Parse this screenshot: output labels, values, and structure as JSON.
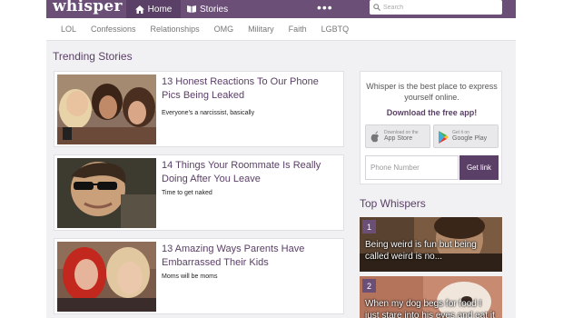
{
  "header": {
    "logo": "whisper",
    "nav_home": "Home",
    "nav_stories": "Stories",
    "more": "•••",
    "search_placeholder": "Search"
  },
  "categories": [
    "LOL",
    "Confessions",
    "Relationships",
    "OMG",
    "Military",
    "Faith",
    "LGBTQ"
  ],
  "trending": {
    "title": "Trending Stories",
    "stories": [
      {
        "title": "13 Honest Reactions To Our Phone Pics Being Leaked",
        "sub": "Everyone's a narcissist, basically"
      },
      {
        "title": "14 Things Your Roommate Is Really Doing After You Leave",
        "sub": "Time to get naked"
      },
      {
        "title": "13 Amazing Ways Parents Have Embarrassed Their Kids",
        "sub": "Moms will be moms"
      }
    ]
  },
  "promo": {
    "text": "Whisper is the best place to express yourself online.",
    "download": "Download the free app!",
    "appstore_small": "Download on the",
    "appstore_big": "App Store",
    "gplay_small": "Get it on",
    "gplay_big": "Google Play",
    "phone_placeholder": "Phone Number",
    "get_link": "Get link"
  },
  "top_whispers": {
    "title": "Top Whispers",
    "items": [
      {
        "num": "1",
        "text": "Being weird is fun but being called weird is no..."
      },
      {
        "num": "2",
        "text": "When my dog begs for food I just stare into his eyes and eat it"
      }
    ]
  },
  "colors": {
    "brand": "#6b4f77",
    "brand_dark": "#5a3f66"
  }
}
